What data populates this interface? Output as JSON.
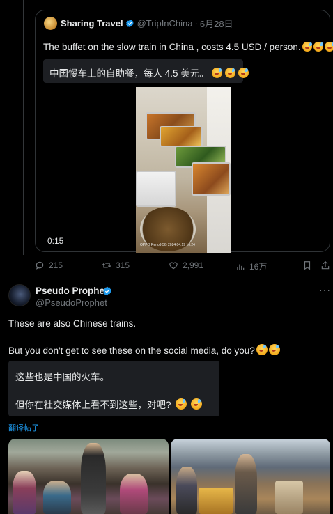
{
  "quoted_tweet": {
    "author_name": "Sharing Travel",
    "author_handle": "@TripInChina",
    "separator": "·",
    "date": "6月28日",
    "text": "The buffet on the slow train in China , costs 4.5 USD / person.",
    "text_emojis": [
      "grinning-sweat",
      "grinning-sweat",
      "grinning-sweat"
    ],
    "translation": "中国慢车上的自助餐，每人 4.5 美元。",
    "video": {
      "duration": "0:15",
      "watermark": "OPPO Reno9 5G\n2024.04.19 10:24"
    }
  },
  "engagement": {
    "replies": "215",
    "retweets": "315",
    "likes": "2,991",
    "views": "16万"
  },
  "post": {
    "author_name": "Pseudo Prophet",
    "author_handle": "@PseudoProphet",
    "more_menu": "···",
    "line1": "These are also Chinese trains.",
    "line2": "But you don't get to see these on the social media, do you?",
    "translation_line1": "这些也是中国的火车。",
    "translation_line2": "但你在社交媒体上看不到这些，对吧?",
    "translate_link": "翻译帖子"
  },
  "colors": {
    "background": "#000000",
    "text": "#e7e9ea",
    "muted": "#71767b",
    "accent": "#1d9bf0",
    "border": "#2f3336",
    "translation_box": "#1d1f23"
  },
  "icons": [
    "verified-badge-icon",
    "reply-icon",
    "retweet-icon",
    "like-icon",
    "views-icon",
    "bookmark-icon",
    "share-icon",
    "more-icon"
  ]
}
